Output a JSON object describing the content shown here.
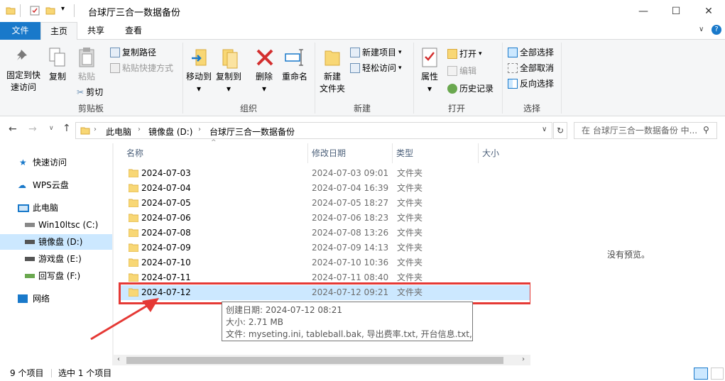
{
  "window": {
    "title": "台球厅三合一数据备份"
  },
  "tabs": {
    "file": "文件",
    "home": "主页",
    "share": "共享",
    "view": "查看"
  },
  "ribbon": {
    "clipboard": {
      "group": "剪贴板",
      "pin": "固定到快\n速访问",
      "copy": "复制",
      "paste": "粘贴",
      "copy_path": "复制路径",
      "paste_shortcut": "粘贴快捷方式",
      "cut": "剪切"
    },
    "organize": {
      "group": "组织",
      "move_to": "移动到",
      "copy_to": "复制到",
      "delete": "删除",
      "rename": "重命名"
    },
    "new": {
      "group": "新建",
      "new_folder": "新建\n文件夹",
      "new_item": "新建项目",
      "easy_access": "轻松访问"
    },
    "open": {
      "group": "打开",
      "properties": "属性",
      "open": "打开",
      "edit": "编辑",
      "history": "历史记录"
    },
    "select": {
      "group": "选择",
      "select_all": "全部选择",
      "select_none": "全部取消",
      "invert": "反向选择"
    }
  },
  "address": {
    "crumbs": [
      "此电脑",
      "镜像盘 (D:)",
      "台球厅三合一数据备份"
    ],
    "search_placeholder": "在 台球厅三合一数据备份 中..."
  },
  "nav": {
    "quick_access": "快速访问",
    "wps": "WPS云盘",
    "this_pc": "此电脑",
    "drives": [
      "Win10ltsc (C:)",
      "镜像盘 (D:)",
      "游戏盘 (E:)",
      "回写盘 (F:)"
    ],
    "network": "网络"
  },
  "columns": {
    "name": "名称",
    "date": "修改日期",
    "type": "类型",
    "size": "大小"
  },
  "rows": [
    {
      "name": "2024-07-03",
      "date": "2024-07-03 09:01",
      "type": "文件夹"
    },
    {
      "name": "2024-07-04",
      "date": "2024-07-04 16:39",
      "type": "文件夹"
    },
    {
      "name": "2024-07-05",
      "date": "2024-07-05 18:27",
      "type": "文件夹"
    },
    {
      "name": "2024-07-06",
      "date": "2024-07-06 18:23",
      "type": "文件夹"
    },
    {
      "name": "2024-07-08",
      "date": "2024-07-08 13:26",
      "type": "文件夹"
    },
    {
      "name": "2024-07-09",
      "date": "2024-07-09 14:13",
      "type": "文件夹"
    },
    {
      "name": "2024-07-10",
      "date": "2024-07-10 10:36",
      "type": "文件夹"
    },
    {
      "name": "2024-07-11",
      "date": "2024-07-11 08:40",
      "type": "文件夹"
    },
    {
      "name": "2024-07-12",
      "date": "2024-07-12 09:21",
      "type": "文件夹"
    }
  ],
  "tooltip": {
    "created": "创建日期: 2024-07-12 08:21",
    "size": "大小: 2.71 MB",
    "files": "文件: myseting.ini, tableball.bak, 导出费率.txt, 开台信息.txt, ..."
  },
  "preview": {
    "empty": "没有预览。"
  },
  "status": {
    "count": "9 个项目",
    "selected": "选中 1 个项目"
  },
  "colors": {
    "accent": "#1979ca",
    "selection": "#cce8ff",
    "highlight": "#e53935"
  }
}
